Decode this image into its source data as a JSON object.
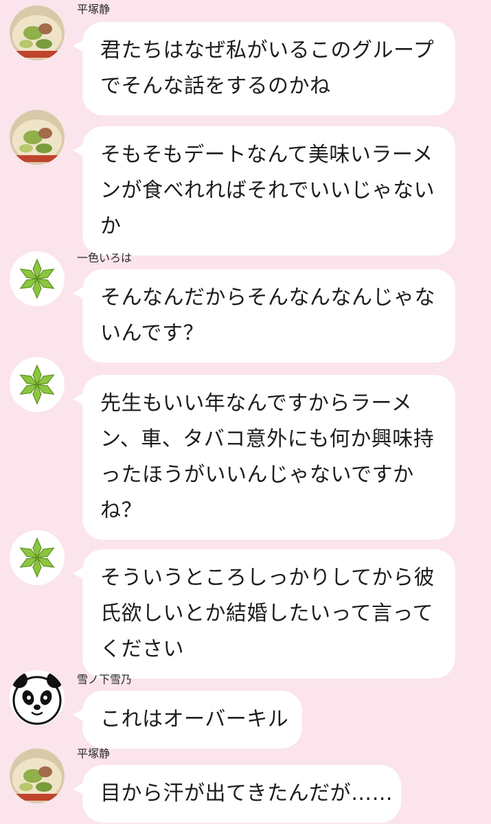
{
  "messages": [
    {
      "sender": "平塚静",
      "avatar": "ramen-avatar-icon",
      "lines": [
        "君たちはなぜ私がいるこのグループ",
        "でそんな話をするのかね"
      ]
    },
    {
      "sender": "",
      "avatar": "ramen-avatar-icon",
      "lines": [
        "そもそもデートなんて美味いラーメ",
        "ンが食べれればそれでいいじゃない",
        "か"
      ]
    },
    {
      "sender": "一色いろは",
      "avatar": "green-star-avatar-icon",
      "lines": [
        "そんなんだからそんなんなんじゃな",
        "いんです？"
      ]
    },
    {
      "sender": "",
      "avatar": "green-star-avatar-icon",
      "lines": [
        "先生もいい年なんですからラーメ",
        "ン、車、タバコ意外にも何か興味持",
        "ったほうがいいんじゃないですか",
        "ね？"
      ]
    },
    {
      "sender": "",
      "avatar": "green-star-avatar-icon",
      "lines": [
        "そういうところしっかりしてから彼",
        "氏欲しいとか結婚したいって言って",
        "ください"
      ]
    },
    {
      "sender": "雪ノ下雪乃",
      "avatar": "panda-avatar-icon",
      "lines": [
        "これはオーバーキル"
      ]
    },
    {
      "sender": "平塚静",
      "avatar": "ramen-avatar-icon",
      "lines": [
        "目から汗が出てきたんだが……"
      ]
    }
  ],
  "colors": {
    "background": "#fbe4ec",
    "bubble": "#ffffff",
    "text": "#1d1d1d"
  }
}
